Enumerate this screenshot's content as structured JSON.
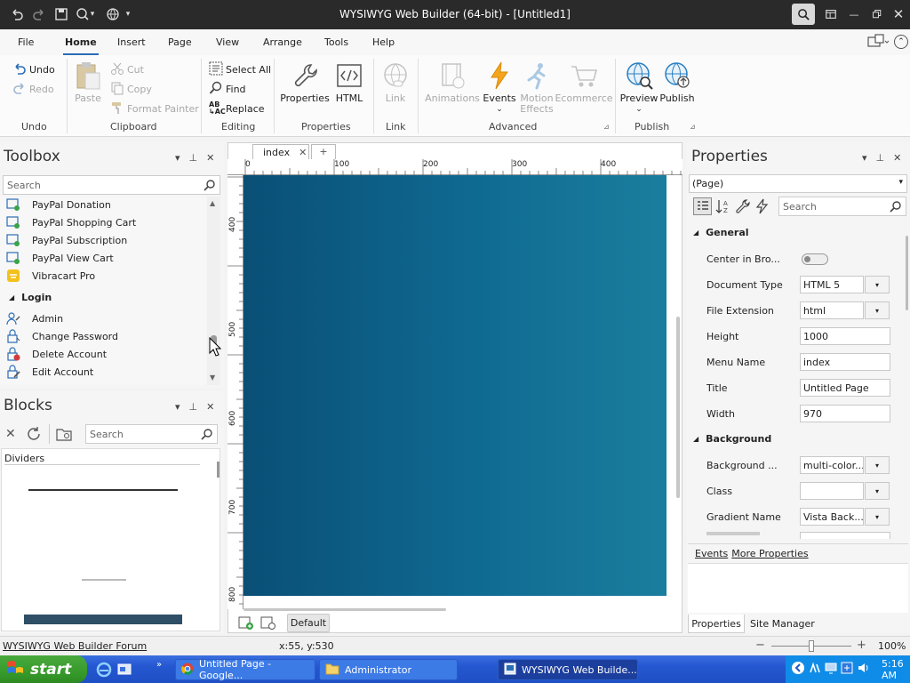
{
  "app": {
    "title": "WYSIWYG Web Builder (64-bit) - [Untitled1]"
  },
  "menu": {
    "items": [
      "File",
      "Home",
      "Insert",
      "Page",
      "View",
      "Arrange",
      "Tools",
      "Help"
    ],
    "active": "Home"
  },
  "ribbon": {
    "undo": "Undo",
    "redo": "Redo",
    "group_undo": "Undo",
    "paste": "Paste",
    "cut": "Cut",
    "copy": "Copy",
    "format_painter": "Format Painter",
    "group_clipboard": "Clipboard",
    "select_all": "Select All",
    "find": "Find",
    "replace": "Replace",
    "group_editing": "Editing",
    "properties": "Properties",
    "html": "HTML",
    "group_properties": "Properties",
    "link": "Link",
    "group_link": "Link",
    "animations": "Animations",
    "events": "Events",
    "motion_effects_1": "Motion",
    "motion_effects_2": "Effects",
    "ecommerce": "Ecommerce",
    "group_advanced": "Advanced",
    "preview": "Preview",
    "publish": "Publish",
    "group_publish": "Publish"
  },
  "toolbox": {
    "title": "Toolbox",
    "search_placeholder": "Search",
    "items": [
      "PayPal Donation",
      "PayPal Shopping Cart",
      "PayPal Subscription",
      "PayPal View Cart",
      "Vibracart Pro"
    ],
    "login_header": "Login",
    "login_items": [
      "Admin",
      "Change Password",
      "Delete Account",
      "Edit Account"
    ]
  },
  "blocks": {
    "title": "Blocks",
    "search_placeholder": "Search",
    "category": "Dividers"
  },
  "document": {
    "tab": "index",
    "add_tab": "+",
    "ruler_h": [
      "0",
      "100",
      "200",
      "300",
      "400"
    ],
    "ruler_v": [
      "400",
      "500",
      "600",
      "700",
      "800"
    ],
    "default_btn": "Default"
  },
  "properties": {
    "title": "Properties",
    "selector": "(Page)",
    "search_placeholder": "Search",
    "general_header": "General",
    "rows": [
      {
        "label": "Center in Bro...",
        "type": "toggle",
        "toggle_on": false
      },
      {
        "label": "Document Type",
        "value": "HTML 5",
        "type": "dropdown"
      },
      {
        "label": "File Extension",
        "value": "html",
        "type": "dropdown"
      },
      {
        "label": "Height",
        "value": "1000",
        "type": "text"
      },
      {
        "label": "Menu Name",
        "value": "index",
        "type": "text"
      },
      {
        "label": "Title",
        "value": "Untitled Page",
        "type": "text"
      },
      {
        "label": "Width",
        "value": "970",
        "type": "text"
      }
    ],
    "background_header": "Background",
    "bg_rows": [
      {
        "label": "Background ...",
        "value": "multi-color...",
        "type": "dropdown"
      },
      {
        "label": "Class",
        "value": "",
        "type": "dropdown"
      },
      {
        "label": "Gradient Name",
        "value": "Vista Back...",
        "type": "dropdown"
      }
    ],
    "events_link": "Events",
    "more_props_link": "More Properties",
    "tab_properties": "Properties",
    "tab_site_manager": "Site Manager"
  },
  "status": {
    "forum_link": "WYSIWYG Web Builder Forum",
    "coords": "x:55, y:530",
    "zoom": "100%",
    "zoom_fraction": 0.5
  },
  "taskbar": {
    "start": "start",
    "tasks": [
      "Untitled Page - Google...",
      "Administrator",
      "WYSIWYG Web Builde..."
    ],
    "clock": "5:16 AM"
  },
  "colors": {
    "accent": "#2a6db5",
    "titlebar": "#2a2a2a",
    "canvas": "#0f6a92"
  }
}
